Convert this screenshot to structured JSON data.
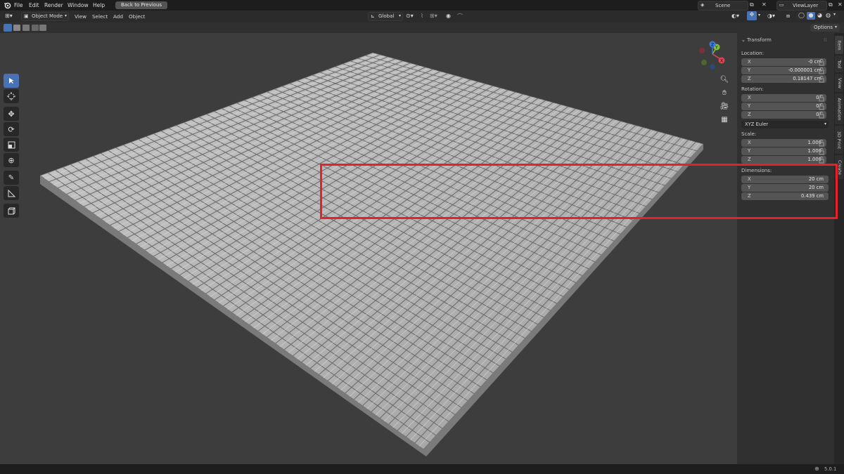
{
  "menu": {
    "items": [
      "File",
      "Edit",
      "Render",
      "Window",
      "Help"
    ],
    "back_button": "Back to Previous"
  },
  "scene": {
    "name": "Scene"
  },
  "view_layer": {
    "name": "ViewLayer"
  },
  "header": {
    "mode": "Object Mode",
    "menus": [
      "View",
      "Select",
      "Add",
      "Object"
    ],
    "transform_orientation": "Global",
    "options": "Options"
  },
  "sidebar": {
    "panel_title": "Transform",
    "location": {
      "label": "Location:",
      "x": {
        "axis": "X",
        "value": "-0 cm"
      },
      "y": {
        "axis": "Y",
        "value": "-0.000001 cm"
      },
      "z": {
        "axis": "Z",
        "value": "0.18147 cm"
      }
    },
    "rotation": {
      "label": "Rotation:",
      "x": {
        "axis": "X",
        "value": "0°"
      },
      "y": {
        "axis": "Y",
        "value": "0°"
      },
      "z": {
        "axis": "Z",
        "value": "0°"
      },
      "mode": "XYZ Euler"
    },
    "scale": {
      "label": "Scale:",
      "x": {
        "axis": "X",
        "value": "1.000"
      },
      "y": {
        "axis": "Y",
        "value": "1.000"
      },
      "z": {
        "axis": "Z",
        "value": "1.000"
      }
    },
    "dimensions": {
      "label": "Dimensions:",
      "x": {
        "axis": "X",
        "value": "20 cm"
      },
      "y": {
        "axis": "Y",
        "value": "20 cm"
      },
      "z": {
        "axis": "Z",
        "value": "0.439 cm"
      }
    },
    "tabs": [
      "Item",
      "Tool",
      "View",
      "Animation",
      "3D Print",
      "Create"
    ]
  },
  "gizmo": {
    "x": "X",
    "y": "Y",
    "z": "Z"
  },
  "status": {
    "version": "5.0.1"
  },
  "colors": {
    "highlight": "#e8202a",
    "active_tool": "#4772b3",
    "x_axis": "#e34452",
    "y_axis": "#80bd3e",
    "z_axis": "#3f7ad6"
  }
}
